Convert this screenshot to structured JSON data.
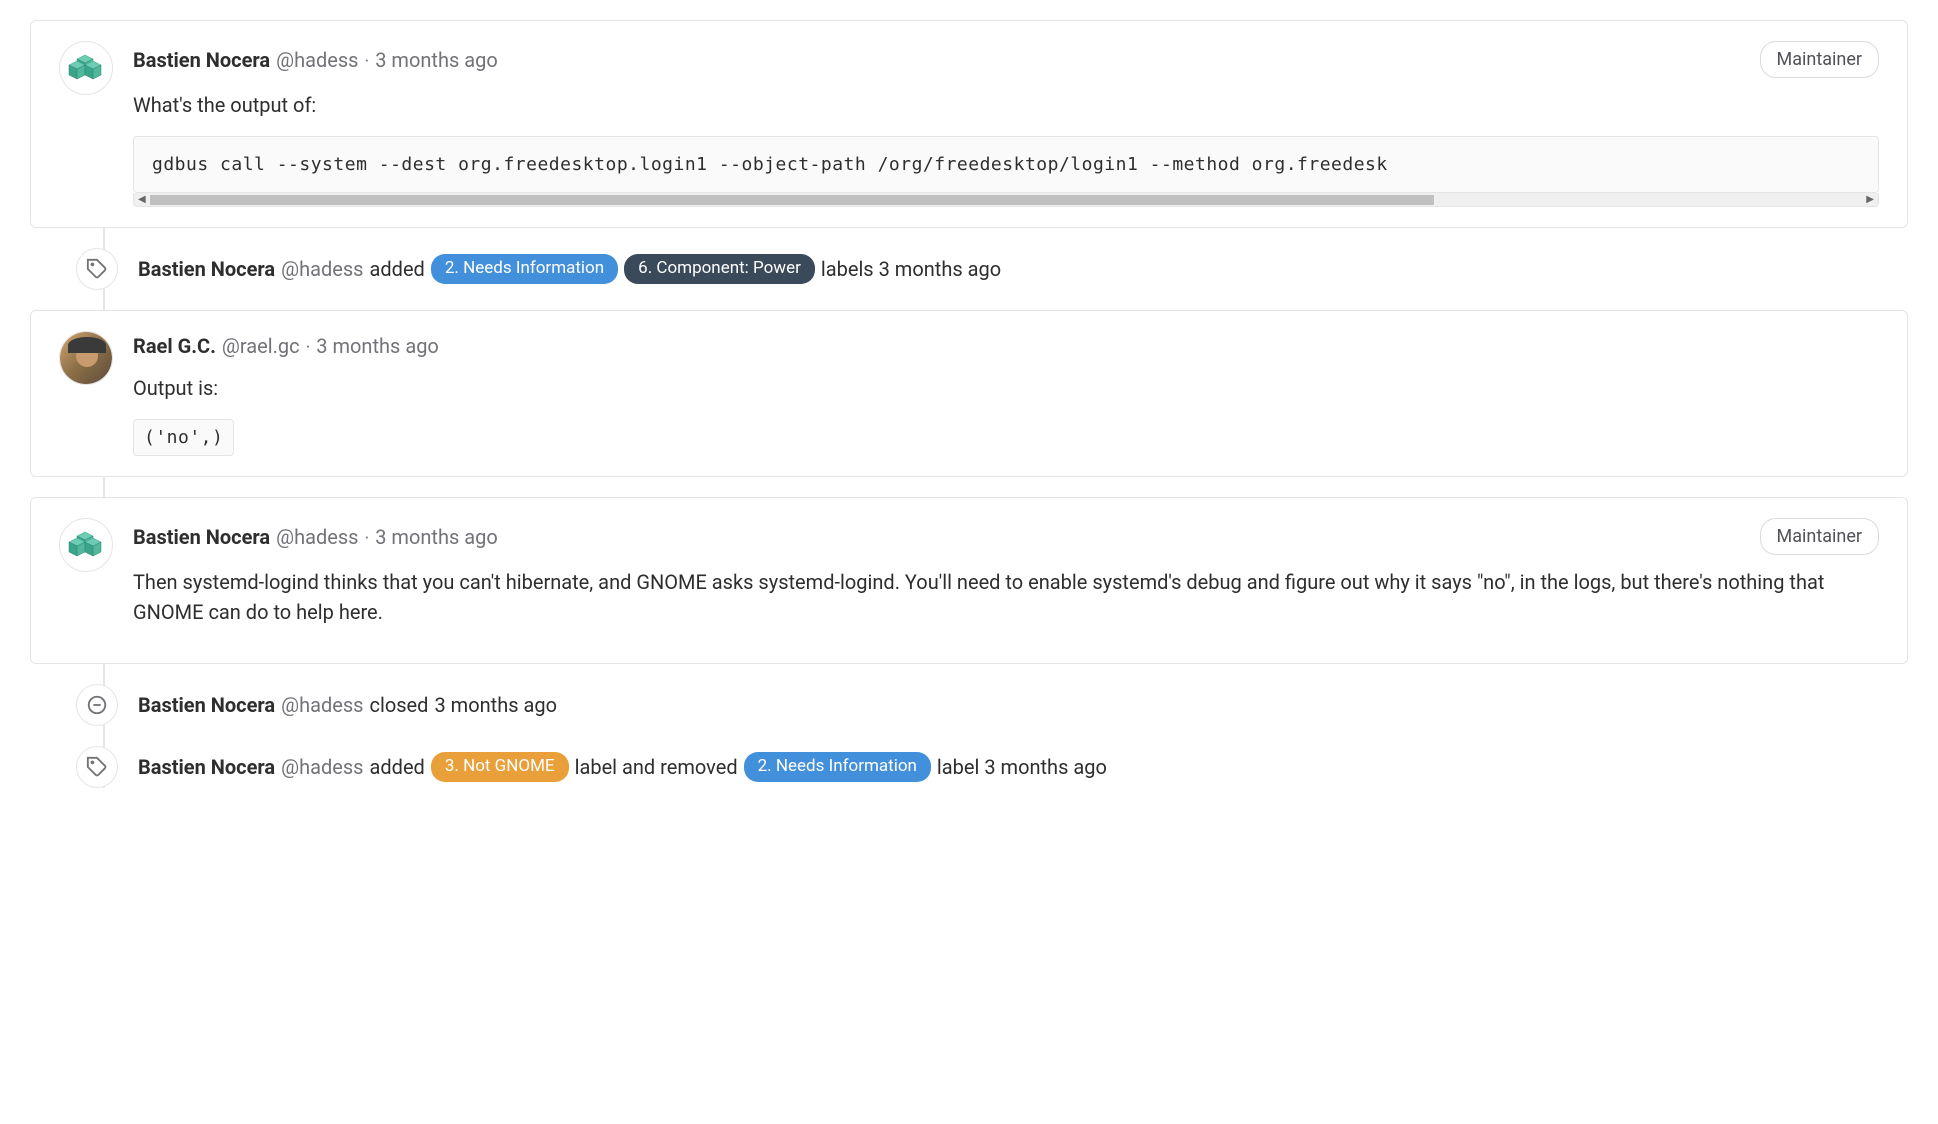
{
  "comments": [
    {
      "author_name": "Bastien Nocera",
      "author_handle": "@hadess",
      "timestamp": "3 months ago",
      "maintainer": "Maintainer",
      "text": "What's the output of:",
      "code": "gdbus call --system --dest org.freedesktop.login1 --object-path /org/freedesktop/login1 --method org.freedesk"
    },
    {
      "author_name": "Rael G.C.",
      "author_handle": "@rael.gc",
      "timestamp": "3 months ago",
      "text": "Output is:",
      "code_inline": "('no',)"
    },
    {
      "author_name": "Bastien Nocera",
      "author_handle": "@hadess",
      "timestamp": "3 months ago",
      "maintainer": "Maintainer",
      "text": "Then systemd-logind thinks that you can't hibernate, and GNOME asks systemd-logind. You'll need to enable systemd's debug and figure out why it says \"no\", in the logs, but there's nothing that GNOME can do to help here."
    }
  ],
  "system_notes": [
    {
      "author_name": "Bastien Nocera",
      "author_handle": "@hadess",
      "action": "added",
      "label1": "2. Needs Information",
      "label2": "6. Component: Power",
      "suffix": "labels 3 months ago"
    },
    {
      "author_name": "Bastien Nocera",
      "author_handle": "@hadess",
      "action": "closed",
      "suffix": "3 months ago"
    },
    {
      "author_name": "Bastien Nocera",
      "author_handle": "@hadess",
      "action": "added",
      "label1": "3. Not GNOME",
      "mid": "label and removed",
      "label2": "2. Needs Information",
      "suffix": "label 3 months ago"
    }
  ],
  "sep": "·"
}
